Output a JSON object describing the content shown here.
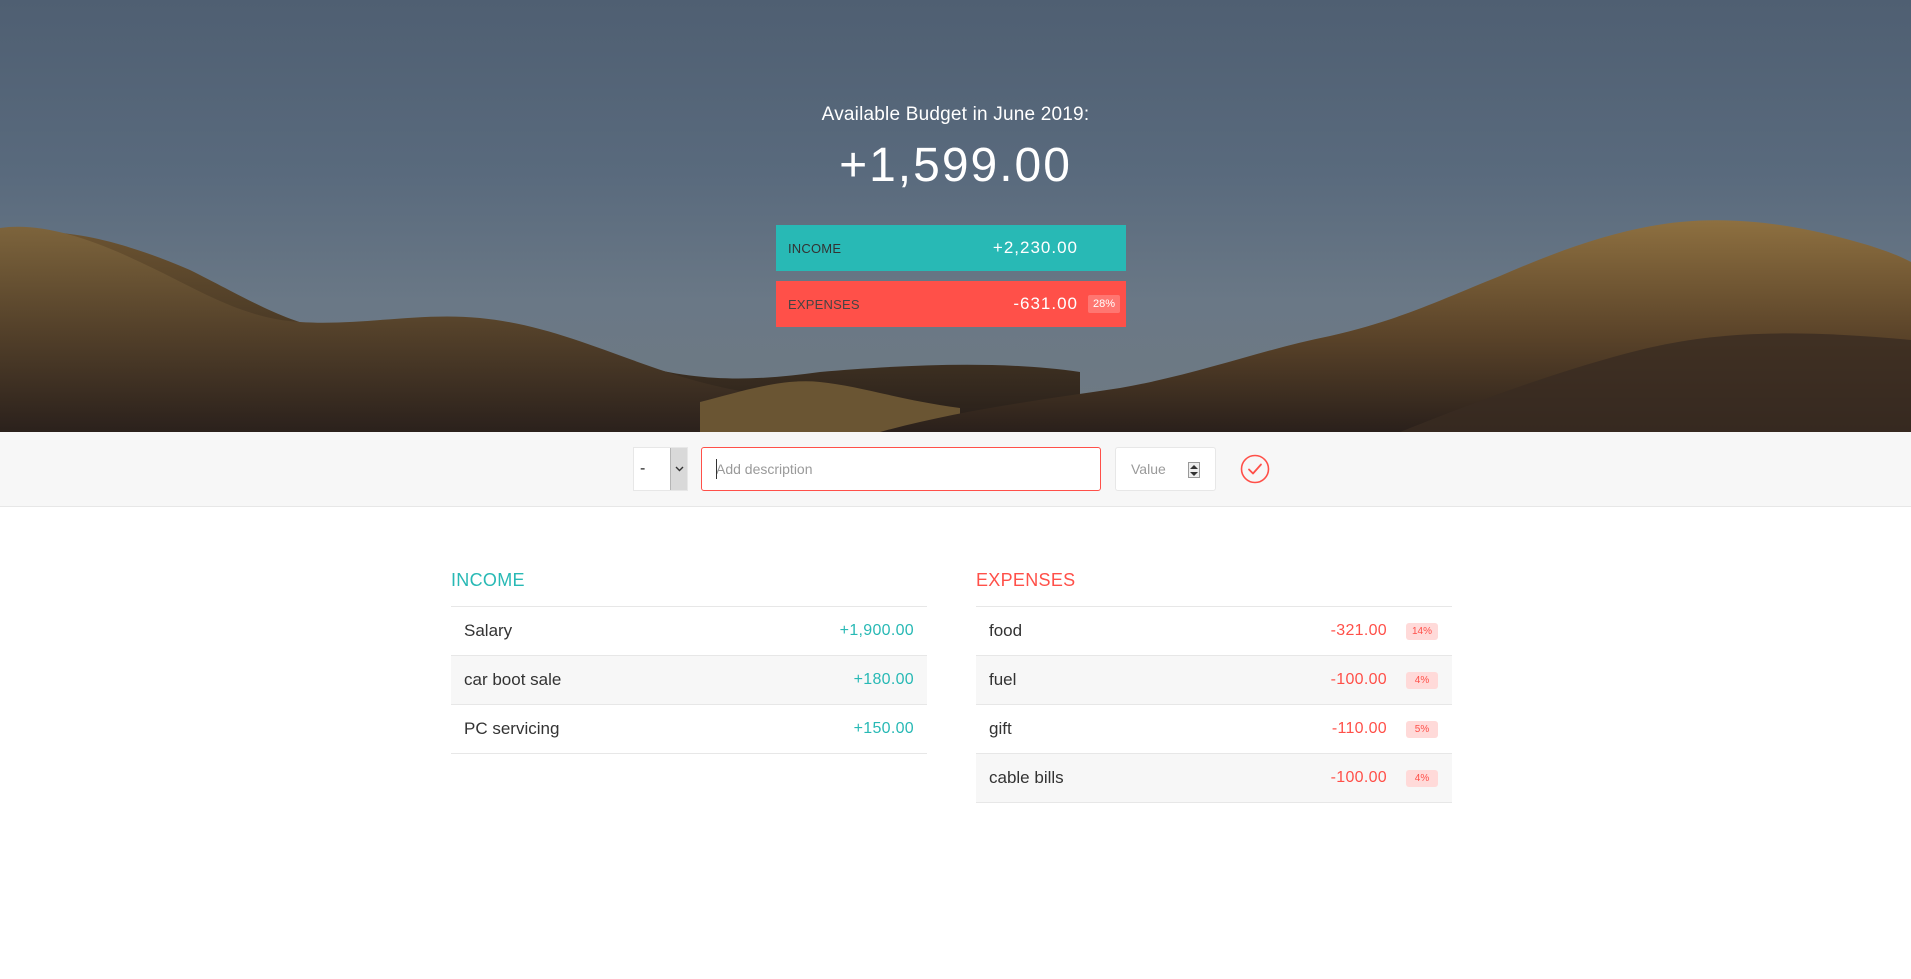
{
  "budget": {
    "title": "Available Budget in June 2019:",
    "value": "+1,599.00",
    "income_label": "INCOME",
    "income_value": "+2,230.00",
    "expenses_label": "EXPENSES",
    "expenses_value": "-631.00",
    "expenses_percentage": "28%"
  },
  "add": {
    "type_value": "-",
    "description_placeholder": "Add description",
    "value_placeholder": "Value",
    "submit_icon": "check-circle-icon"
  },
  "income": {
    "title": "INCOME",
    "items": [
      {
        "description": "Salary",
        "value": "+1,900.00"
      },
      {
        "description": "car boot sale",
        "value": "+180.00"
      },
      {
        "description": "PC servicing",
        "value": "+150.00"
      }
    ]
  },
  "expenses": {
    "title": "EXPENSES",
    "items": [
      {
        "description": "food",
        "value": "-321.00",
        "percentage": "14%"
      },
      {
        "description": "fuel",
        "value": "-100.00",
        "percentage": "4%"
      },
      {
        "description": "gift",
        "value": "-110.00",
        "percentage": "5%"
      },
      {
        "description": "cable bills",
        "value": "-100.00",
        "percentage": "4%"
      }
    ]
  },
  "colors": {
    "income": "#28b9b5",
    "expenses": "#ff5049",
    "hero_sky": "#56677a",
    "hills": "#6e5530"
  }
}
